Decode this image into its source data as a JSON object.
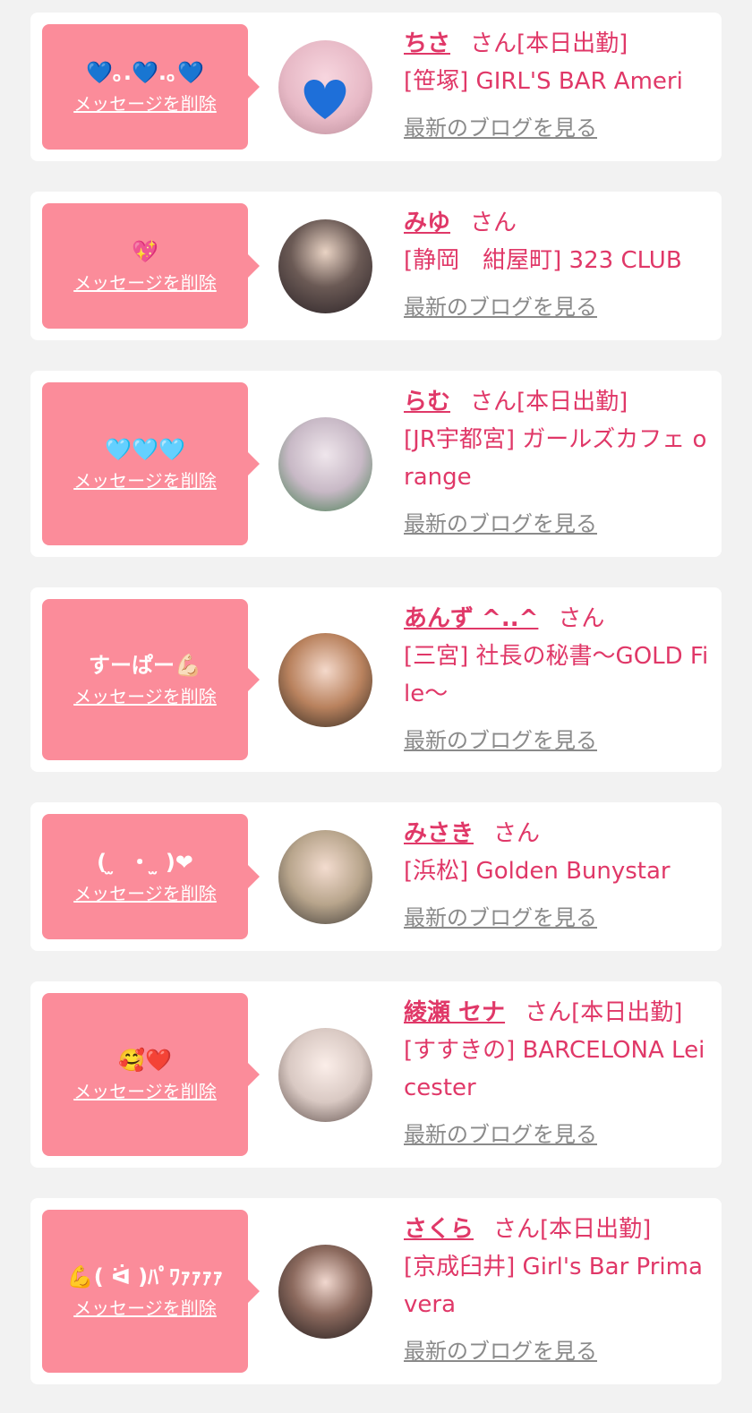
{
  "colors": {
    "accent": "#e03868",
    "bubble": "#fb8c9a",
    "background": "#f2f2f2",
    "link_gray": "#8a8a8a"
  },
  "delete_label": "メッセージを削除",
  "blog_label": "最新のブログを見る",
  "cards": [
    {
      "message": "💙｡.💙.｡💙",
      "name": "ちさ",
      "suffix": "さん[本日出勤]",
      "shop": "[笹塚] GIRL'S BAR Ameri",
      "avatar_icon": "blue-heart-avatar"
    },
    {
      "message": "💖",
      "name": "みゆ",
      "suffix": "さん",
      "shop": "[静岡　紺屋町] 323 CLUB",
      "avatar_icon": "avatar-photo"
    },
    {
      "message": "🩵🩵🩵",
      "name": "らむ",
      "suffix": "さん[本日出勤]",
      "shop": "[JR宇都宮] ガールズカフェ orange",
      "avatar_icon": "avatar-photo"
    },
    {
      "message": "すーぱー💪🏻",
      "name": "あんず ^..^",
      "suffix": "さん",
      "shop": "[三宮] 社長の秘書〜GOLD File〜",
      "avatar_icon": "avatar-photo"
    },
    {
      "message": "(​ ̫ ​ ・ ̫ ​)❤",
      "name": "みさき",
      "suffix": "さん",
      "shop": "[浜松] Golden Bunystar",
      "avatar_icon": "avatar-photo"
    },
    {
      "message": "🥰❤️",
      "name": "綾瀬 セナ",
      "suffix": "さん[本日出勤]",
      "shop": "[すすきの] BARCELONA Leicester",
      "avatar_icon": "avatar-photo"
    },
    {
      "message": "💪( ᐛ )ﾊﾟﾜｧｧｧｧ",
      "name": "さくら",
      "suffix": "さん[本日出勤]",
      "shop": "[京成臼井] Girl's Bar Primavera",
      "avatar_icon": "avatar-photo"
    }
  ]
}
